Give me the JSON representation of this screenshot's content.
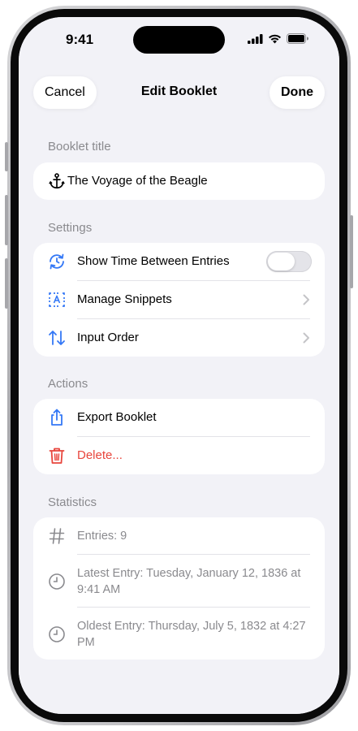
{
  "status_bar": {
    "time": "9:41"
  },
  "nav": {
    "cancel_label": "Cancel",
    "title": "Edit Booklet",
    "done_label": "Done"
  },
  "booklet_title": {
    "header": "Booklet title",
    "value": "The Voyage of the Beagle",
    "icon": "anchor-icon"
  },
  "settings": {
    "header": "Settings",
    "items": [
      {
        "label": "Show Time Between Entries",
        "icon": "clock-arrows-icon",
        "toggle_on": false
      },
      {
        "label": "Manage Snippets",
        "icon": "text-box-icon"
      },
      {
        "label": "Input Order",
        "icon": "up-down-arrows-icon"
      }
    ]
  },
  "actions": {
    "header": "Actions",
    "items": [
      {
        "label": "Export Booklet",
        "icon": "share-icon"
      },
      {
        "label": "Delete...",
        "icon": "trash-icon"
      }
    ]
  },
  "statistics": {
    "header": "Statistics",
    "items": [
      {
        "label": "Entries: 9",
        "icon": "hash-icon"
      },
      {
        "label": "Latest Entry: Tuesday, January 12, 1836 at 9:41 AM",
        "icon": "clock-icon"
      },
      {
        "label": "Oldest Entry: Thursday, July 5, 1832 at 4:27 PM",
        "icon": "clock-icon"
      }
    ]
  },
  "colors": {
    "accent": "#3478f6",
    "danger": "#e8453c",
    "secondary_text": "#8a8a8e",
    "background": "#f2f2f7"
  }
}
